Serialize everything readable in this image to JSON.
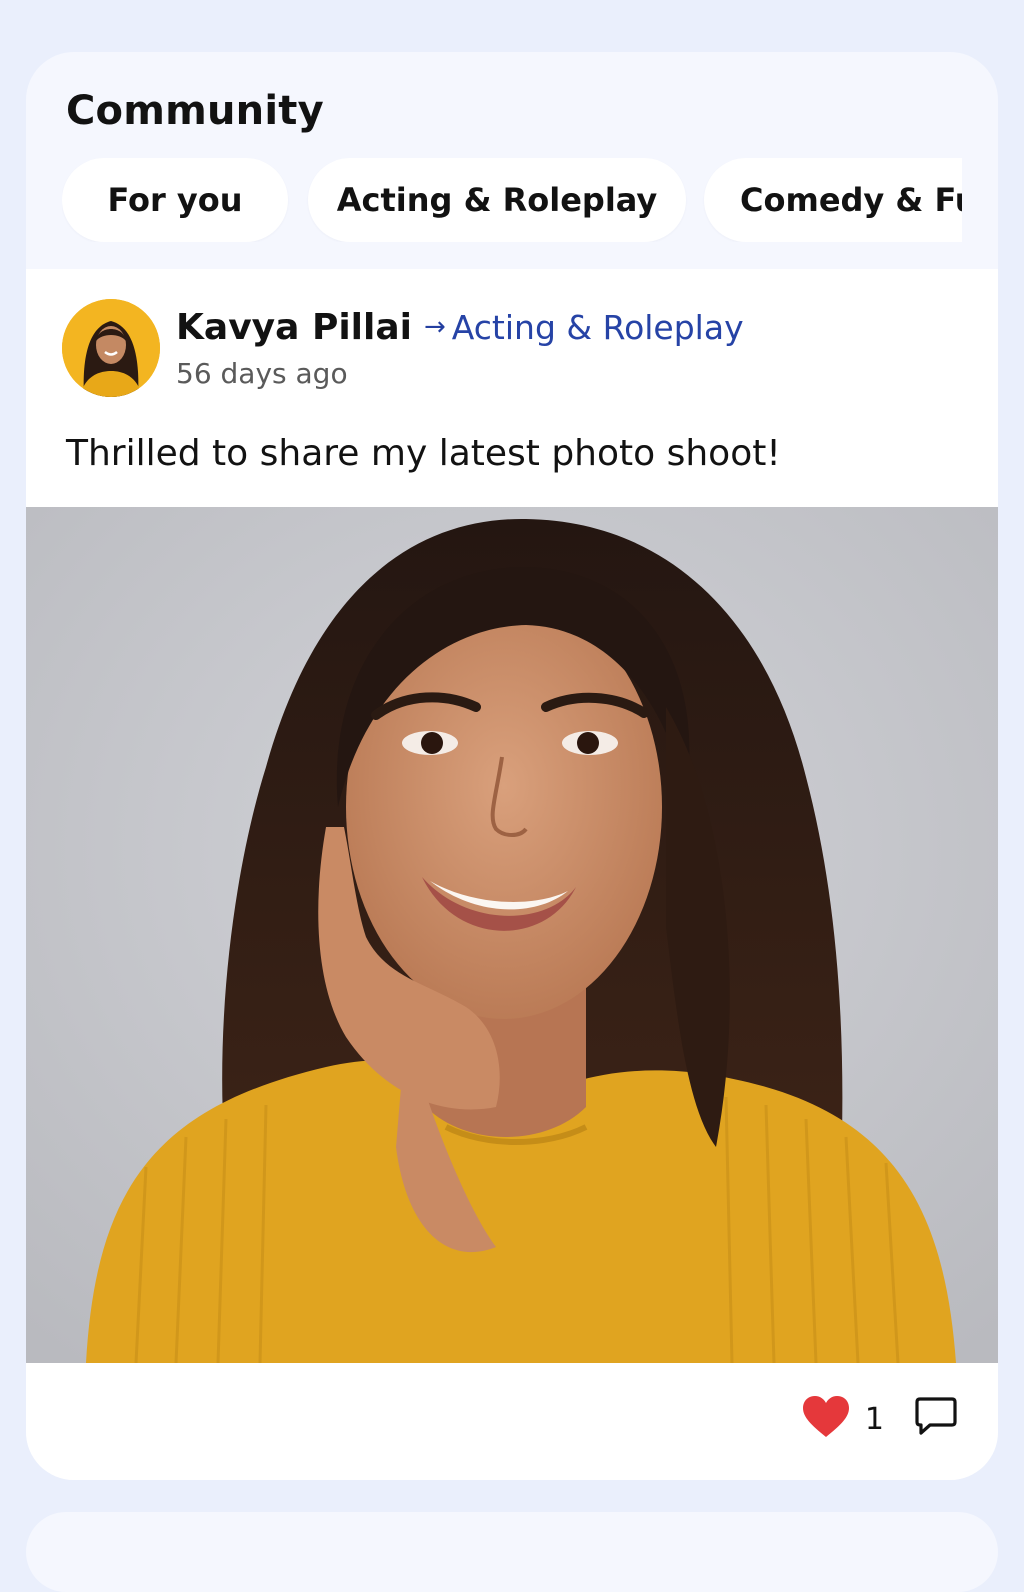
{
  "header": {
    "title": "Community"
  },
  "tabs": [
    {
      "label": "For you"
    },
    {
      "label": "Acting & Roleplay"
    },
    {
      "label": "Comedy & Fu"
    }
  ],
  "post": {
    "author": "Kavya Pillai",
    "arrow": "→",
    "community": "Acting & Roleplay",
    "time": "56 days ago",
    "text": "Thrilled to share my latest photo shoot!",
    "likes": "1"
  },
  "icons": {
    "like": "heart-icon",
    "comment": "speech-bubble-icon"
  },
  "colors": {
    "page_bg": "#eaeffc",
    "card_bg": "#f5f7fe",
    "link": "#2643a6",
    "heart": "#e5383b",
    "avatar_bg": "#f3b521",
    "sweater": "#e0a420"
  }
}
